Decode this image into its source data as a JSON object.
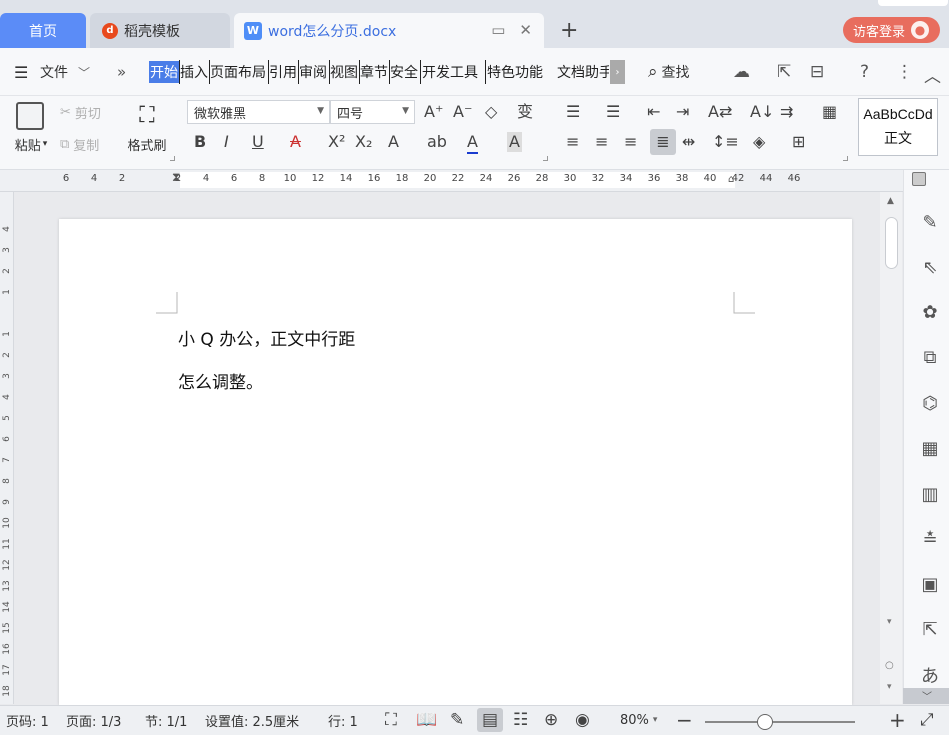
{
  "tabs": {
    "home": "首页",
    "template": "稻壳模板",
    "document": "word怎么分页.docx",
    "login": "访客登录"
  },
  "menu": {
    "file": "文件",
    "ribbon_tabs": [
      "开始",
      "插入",
      "页面布局",
      "引用",
      "审阅",
      "视图",
      "章节",
      "安全",
      "开发工具",
      "特色功能",
      "文档助手"
    ],
    "search": "查找"
  },
  "ribbon": {
    "paste": "粘贴",
    "cut": "剪切",
    "copy": "复制",
    "format_painter": "格式刷",
    "font_name": "微软雅黑",
    "font_size": "四号",
    "style_sample": "AaBbCcDd",
    "style_name": "正文"
  },
  "ruler": {
    "numbers": [
      "6",
      "4",
      "2",
      "2",
      "4",
      "6",
      "8",
      "10",
      "12",
      "14",
      "16",
      "18",
      "20",
      "22",
      "24",
      "26",
      "28",
      "30",
      "32",
      "34",
      "36",
      "38",
      "40",
      "42",
      "44",
      "46"
    ],
    "vertical_numbers": [
      "4",
      "3",
      "2",
      "1",
      "1",
      "2",
      "3",
      "4",
      "5",
      "6",
      "7",
      "8",
      "9",
      "10",
      "11",
      "12",
      "13",
      "14",
      "15",
      "16",
      "17",
      "18"
    ]
  },
  "document": {
    "line1": "小 Q 办公，正文中行距",
    "line2": "怎么调整。"
  },
  "status": {
    "page_no": "页码: 1",
    "pages": "页面: 1/3",
    "section": "节: 1/1",
    "setting": "设置值: 2.5厘米",
    "row": "行: 1",
    "zoom": "80%",
    "zoom_level": 0.4
  },
  "icons": {
    "active_tab_color": "#5b8cf7",
    "login_color": "#e86d5e",
    "ribbon_active_color": "#4a7de8"
  }
}
